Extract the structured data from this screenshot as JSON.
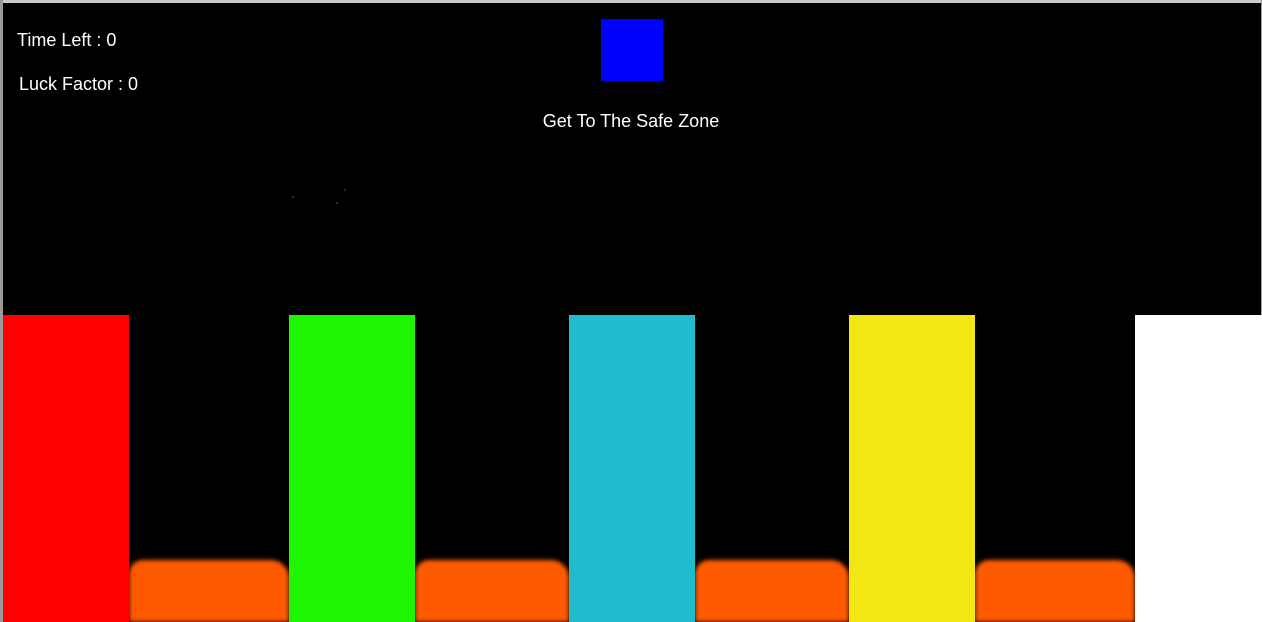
{
  "hud": {
    "time_left": "Time Left : 0",
    "luck_factor": "Luck Factor : 0"
  },
  "objective": "Get To The Safe Zone",
  "colors": {
    "background": "#000000",
    "player": "#0000ff",
    "lava": "#ff5a00",
    "pillars": [
      "#ff0000",
      "#1ef500",
      "#20bbcc",
      "#f2e614",
      "#ffffff"
    ]
  },
  "icons": {
    "player": "blue-square-player",
    "lava": "molten-lava"
  }
}
